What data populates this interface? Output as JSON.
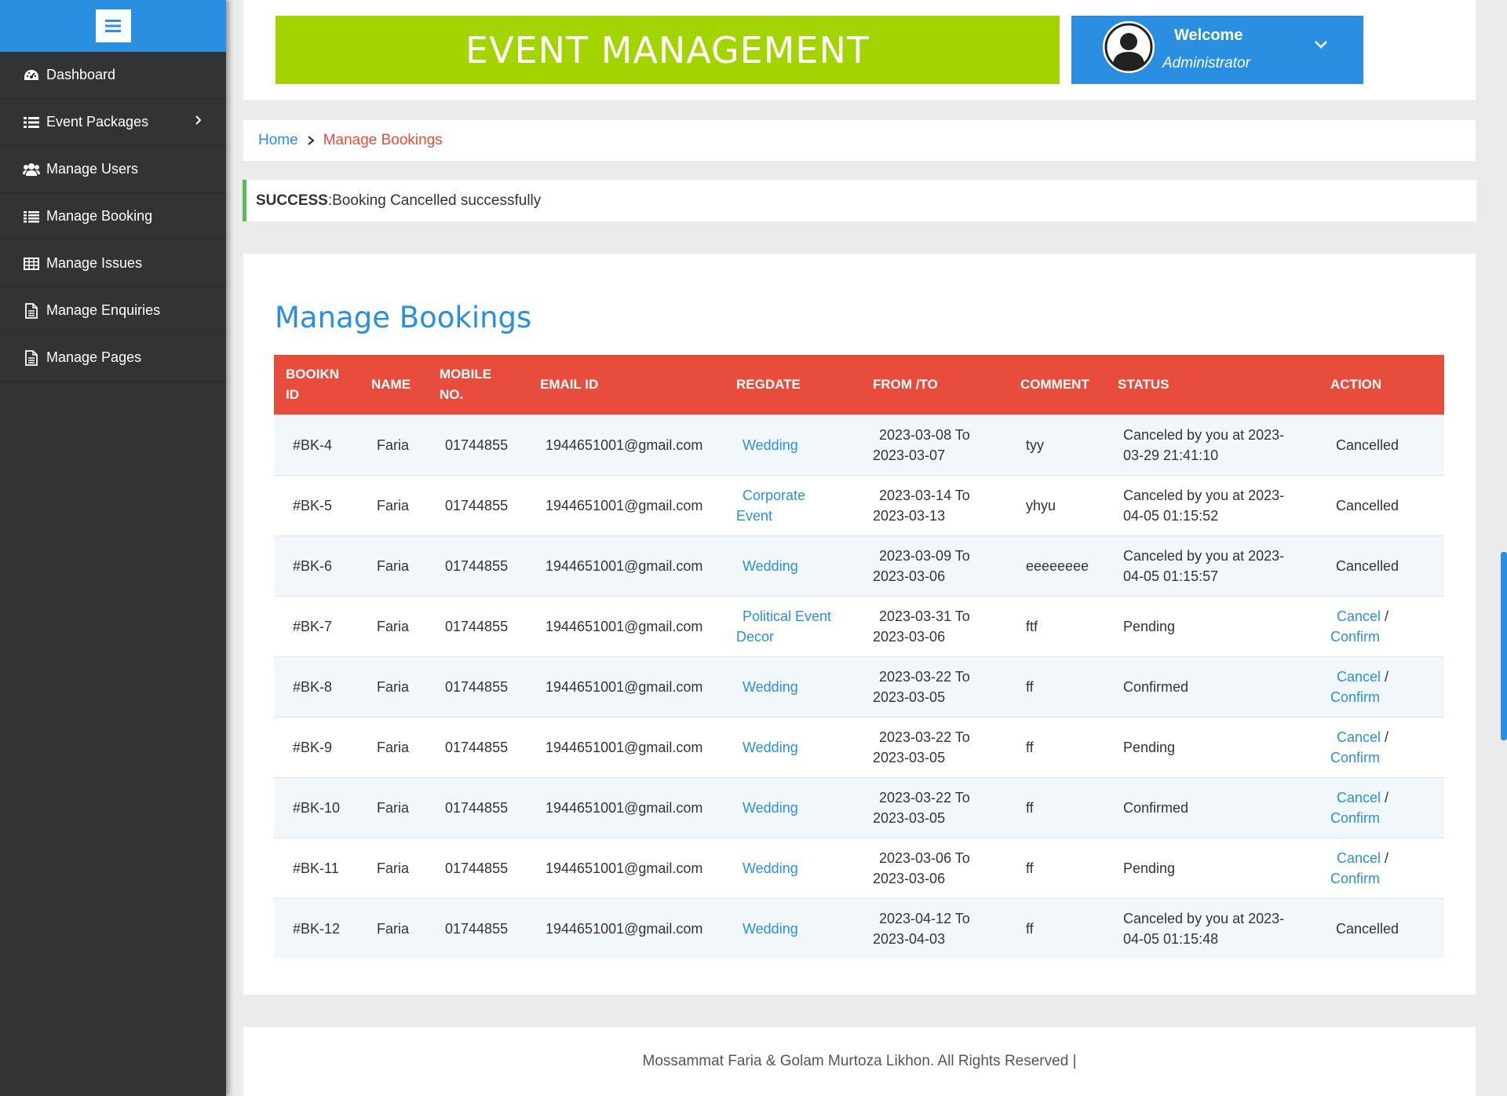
{
  "sidebar": {
    "items": [
      {
        "label": "Dashboard",
        "icon": "dashboard-icon"
      },
      {
        "label": "Event Packages",
        "icon": "list-icon"
      },
      {
        "label": "Manage Users",
        "icon": "users-icon"
      },
      {
        "label": "Manage Booking",
        "icon": "list-icon"
      },
      {
        "label": "Manage Issues",
        "icon": "table-icon"
      },
      {
        "label": "Manage Enquiries",
        "icon": "document-icon"
      },
      {
        "label": "Manage Pages",
        "icon": "document-icon"
      }
    ]
  },
  "header": {
    "brand": "EVENT MANAGEMENT",
    "welcome_title": "Welcome",
    "welcome_user": "Administrator"
  },
  "breadcrumb": {
    "home": "Home",
    "current": "Manage Bookings"
  },
  "alert": {
    "label": "SUCCESS",
    "message": ":Booking Cancelled successfully"
  },
  "main": {
    "title": "Manage Bookings",
    "table": {
      "headers": {
        "id": "BOOIKN ID",
        "name": "NAME",
        "mobile": "MOBILE NO.",
        "email": "EMAIL ID",
        "regdate": "REGDATE",
        "fromto": "FROM /TO",
        "comment": "COMMENT",
        "status": "STATUS",
        "action": "ACTION"
      },
      "rows": [
        {
          "id": "#BK-4",
          "name": "Faria",
          "mobile": "01744855",
          "email": "1944651001@gmail.com",
          "event": "Wedding",
          "from": "2023-03-08 To",
          "to": "2023-03-07",
          "comment": "tyy",
          "status": "Canceled by you at 2023-03-29 21:41:10",
          "action": "Cancelled"
        },
        {
          "id": "#BK-5",
          "name": "Faria",
          "mobile": "01744855",
          "email": "1944651001@gmail.com",
          "event": "Corporate Event",
          "from": "2023-03-14 To",
          "to": "2023-03-13",
          "comment": "yhyu",
          "status": "Canceled by you at 2023-04-05 01:15:52",
          "action": "Cancelled"
        },
        {
          "id": "#BK-6",
          "name": "Faria",
          "mobile": "01744855",
          "email": "1944651001@gmail.com",
          "event": "Wedding",
          "from": "2023-03-09 To",
          "to": "2023-03-06",
          "comment": "eeeeeeee",
          "status": "Canceled by you at 2023-04-05 01:15:57",
          "action": "Cancelled"
        },
        {
          "id": "#BK-7",
          "name": "Faria",
          "mobile": "01744855",
          "email": "1944651001@gmail.com",
          "event": "Political Event Decor",
          "from": "2023-03-31 To",
          "to": "2023-03-06",
          "comment": "ftf",
          "status": "Pending",
          "action": "Cancel / Confirm"
        },
        {
          "id": "#BK-8",
          "name": "Faria",
          "mobile": "01744855",
          "email": "1944651001@gmail.com",
          "event": "Wedding",
          "from": "2023-03-22 To",
          "to": "2023-03-05",
          "comment": "ff",
          "status": "Confirmed",
          "action": "Cancel / Confirm"
        },
        {
          "id": "#BK-9",
          "name": "Faria",
          "mobile": "01744855",
          "email": "1944651001@gmail.com",
          "event": "Wedding",
          "from": "2023-03-22 To",
          "to": "2023-03-05",
          "comment": "ff",
          "status": "Pending",
          "action": "Cancel / Confirm"
        },
        {
          "id": "#BK-10",
          "name": "Faria",
          "mobile": "01744855",
          "email": "1944651001@gmail.com",
          "event": "Wedding",
          "from": "2023-03-22 To",
          "to": "2023-03-05",
          "comment": "ff",
          "status": "Confirmed",
          "action": "Cancel / Confirm"
        },
        {
          "id": "#BK-11",
          "name": "Faria",
          "mobile": "01744855",
          "email": "1944651001@gmail.com",
          "event": "Wedding",
          "from": "2023-03-06 To",
          "to": "2023-03-06",
          "comment": "ff",
          "status": "Pending",
          "action": "Cancel / Confirm"
        },
        {
          "id": "#BK-12",
          "name": "Faria",
          "mobile": "01744855",
          "email": "1944651001@gmail.com",
          "event": "Wedding",
          "from": "2023-04-12 To",
          "to": "2023-04-03",
          "comment": "ff",
          "status": "Canceled by you at 2023-04-05 01:15:48",
          "action": "Cancelled"
        }
      ]
    }
  },
  "footer": {
    "text": "Mossammat Faria & Golam Murtoza Likhon. All Rights Reserved |"
  },
  "colors": {
    "primary": "#2a8fe0",
    "brand_green": "#a4d400",
    "table_header": "#e74c3c",
    "sidebar_bg": "#333333",
    "success_border": "#5cb85c"
  }
}
